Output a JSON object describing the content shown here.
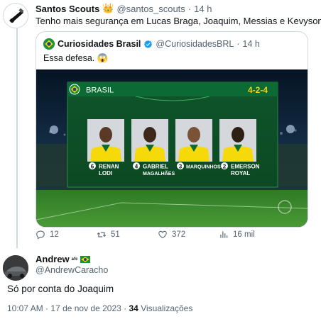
{
  "tweet": {
    "name": "Santos Scouts",
    "name_emoji": "👑",
    "handle": "@santos_scouts",
    "separator": "·",
    "time": "14 h",
    "text": "Tenho mais segurança em Lucas Braga, Joaquim, Messias e Kevyson."
  },
  "quote": {
    "name": "Curiosidades Brasil",
    "handle": "@CuriosidadesBRL",
    "separator": "·",
    "time": "14 h",
    "text": "Essa defesa. 😱",
    "graphic": {
      "team": "BRASIL",
      "formation": "4-2-4",
      "players": [
        {
          "number": "6",
          "first": "RENAN",
          "last": "LODI"
        },
        {
          "number": "4",
          "first": "GABRIEL",
          "last": "MAGALHÃES"
        },
        {
          "number": "3",
          "first": "MARQUINHOS",
          "last": ""
        },
        {
          "number": "2",
          "first": "EMERSON",
          "last": "ROYAL"
        }
      ]
    }
  },
  "actions": {
    "replies": "12",
    "retweets": "51",
    "likes": "372",
    "views": "16 mil"
  },
  "reply": {
    "name": "Andrew",
    "name_suffix": "ᵃᶠᶜ",
    "handle": "@AndrewCaracho",
    "text": "Só por conta do Joaquim",
    "time": "10:07 AM",
    "separator": "·",
    "date": "17 de nov de 2023",
    "separator2": "·",
    "views_count": "34",
    "views_label": "Visualizações"
  },
  "colors": {
    "text": "#0f1419",
    "muted": "#536471",
    "border": "#cfd9de",
    "verified": "#1d9bf0",
    "banner_green": "#0c6b34",
    "formation_yellow": "#f2d21b",
    "jersey_yellow": "#f5d90a",
    "pitch_green": "#3e8b2e"
  },
  "icons": [
    "reply-icon",
    "retweet-icon",
    "like-icon",
    "views-icon",
    "verified-badge-icon",
    "brazil-flag-icon"
  ]
}
